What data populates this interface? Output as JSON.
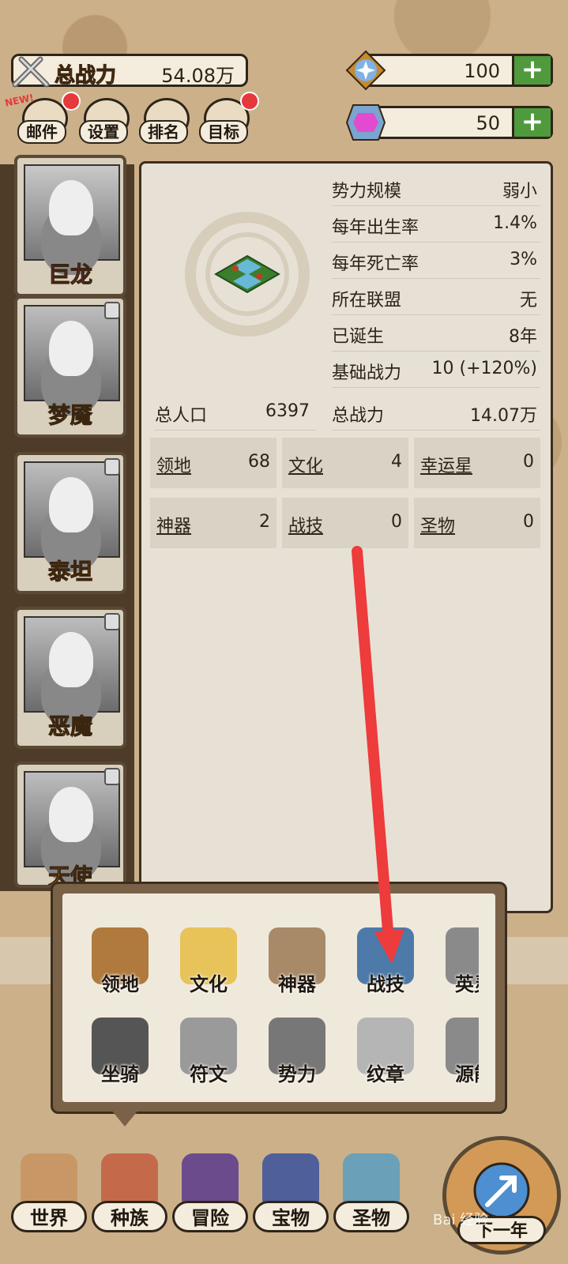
{
  "header": {
    "power_label": "总战力",
    "power_value": "54.08万",
    "new_tag": "NEW!",
    "resource1_value": "100",
    "resource2_value": "50",
    "plus": "+"
  },
  "quick_buttons": [
    "邮件",
    "设置",
    "排名",
    "目标"
  ],
  "heroes": [
    {
      "name": "巨龙",
      "color": "#e23ad6"
    },
    {
      "name": "梦魇",
      "color": "#f39a1a"
    },
    {
      "name": "泰坦",
      "color": "#f39a1a"
    },
    {
      "name": "恶魔",
      "color": "#f39a1a"
    },
    {
      "name": "天使",
      "color": "#f39a1a"
    }
  ],
  "stats": [
    {
      "k": "势力规模",
      "v": "弱小"
    },
    {
      "k": "每年出生率",
      "v": "1.4%"
    },
    {
      "k": "每年死亡率",
      "v": "3%"
    },
    {
      "k": "所在联盟",
      "v": "无"
    },
    {
      "k": "已诞生",
      "v": "8年"
    },
    {
      "k": "基础战力",
      "v": "10 (+120%)"
    },
    {
      "k": "总战力",
      "v": "14.07万"
    }
  ],
  "population": {
    "k": "总人口",
    "v": "6397"
  },
  "grid": [
    {
      "k": "领地",
      "v": "68"
    },
    {
      "k": "文化",
      "v": "4"
    },
    {
      "k": "幸运星",
      "v": "0"
    },
    {
      "k": "神器",
      "v": "2"
    },
    {
      "k": "战技",
      "v": "0"
    },
    {
      "k": "圣物",
      "v": "0"
    }
  ],
  "popup_items": [
    {
      "label": "领地",
      "color": "#b07a3e"
    },
    {
      "label": "文化",
      "color": "#e8c35a"
    },
    {
      "label": "神器",
      "color": "#a88968"
    },
    {
      "label": "战技",
      "color": "#4d7aa8"
    },
    {
      "label": "英灵",
      "color": "#8a8a8a"
    },
    {
      "label": "坐骑",
      "color": "#555555"
    },
    {
      "label": "符文",
      "color": "#9a9a9a"
    },
    {
      "label": "势力",
      "color": "#777777"
    },
    {
      "label": "纹章",
      "color": "#b5b5b5"
    },
    {
      "label": "源能",
      "color": "#8a8a8a"
    }
  ],
  "bottom_nav": [
    {
      "label": "世界",
      "color": "#c99766"
    },
    {
      "label": "种族",
      "color": "#c46a4a"
    },
    {
      "label": "冒险",
      "color": "#6b4b8c"
    },
    {
      "label": "宝物",
      "color": "#4f5f9a"
    },
    {
      "label": "圣物",
      "color": "#6aa0b8"
    },
    {
      "label": "下一年",
      "color": "#4d8fd0"
    }
  ],
  "watermark": "Bai 经验"
}
